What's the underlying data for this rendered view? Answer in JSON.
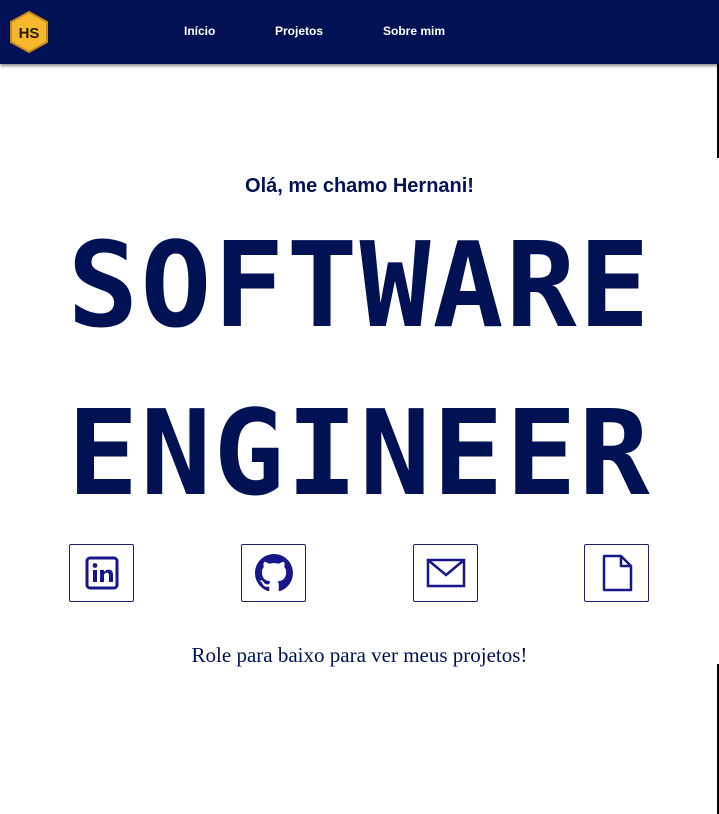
{
  "nav": {
    "logo_text": "HS",
    "items": [
      {
        "label": "Início"
      },
      {
        "label": "Projetos"
      },
      {
        "label": "Sobre mim"
      }
    ]
  },
  "hero": {
    "greeting": "Olá, me chamo Hernani!",
    "headline_line1": "SOFTWARE",
    "headline_line2": "ENGINEER"
  },
  "social": [
    {
      "icon": "linkedin-icon"
    },
    {
      "icon": "github-icon"
    },
    {
      "icon": "mail-icon"
    },
    {
      "icon": "document-icon"
    }
  ],
  "scroll_hint": "Role para baixo para ver meus projetos!",
  "colors": {
    "navy": "#001154",
    "logo_yellow": "#f5b82e",
    "icon_blue": "#16168a"
  }
}
